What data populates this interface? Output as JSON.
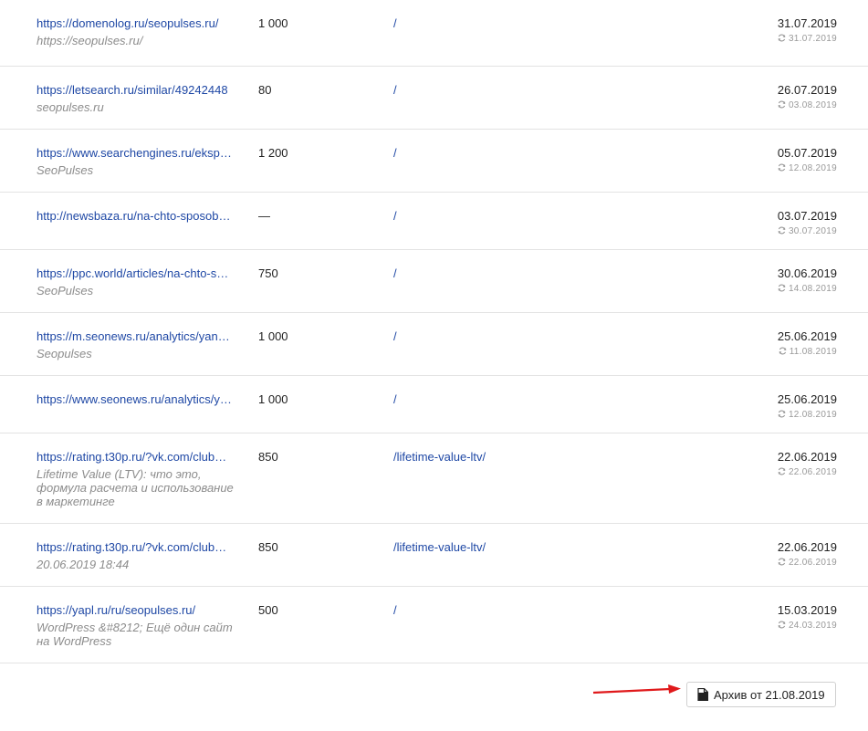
{
  "rows": [
    {
      "url": "https://domenolog.ru/seopulses.ru/",
      "desc": "https://seopulses.ru/",
      "count": "1 000",
      "target": "/",
      "date": "31.07.2019",
      "updated": "31.07.2019"
    },
    {
      "url": "https://letsearch.ru/similar/49242448",
      "desc": "seopulses.ru",
      "count": "80",
      "target": "/",
      "date": "26.07.2019",
      "updated": "03.08.2019"
    },
    {
      "url": "https://www.searchengines.ru/eksp…",
      "desc": "SeoPulses",
      "count": "1 200",
      "target": "/",
      "date": "05.07.2019",
      "updated": "12.08.2019"
    },
    {
      "url": "http://newsbaza.ru/na-chto-sposob…",
      "desc": "",
      "count": "—",
      "target": "/",
      "date": "03.07.2019",
      "updated": "30.07.2019"
    },
    {
      "url": "https://ppc.world/articles/na-chto-s…",
      "desc": "SeoPulses",
      "count": "750",
      "target": "/",
      "date": "30.06.2019",
      "updated": "14.08.2019"
    },
    {
      "url": "https://m.seonews.ru/analytics/yan…",
      "desc": "Seopulses",
      "count": "1 000",
      "target": "/",
      "date": "25.06.2019",
      "updated": "11.08.2019"
    },
    {
      "url": "https://www.seonews.ru/analytics/y…",
      "desc": "",
      "count": "1 000",
      "target": "/",
      "date": "25.06.2019",
      "updated": "12.08.2019"
    },
    {
      "url": "https://rating.t30p.ru/?vk.com/club…",
      "desc": "Lifetime Value (LTV): что это, формула расчета и использование в маркетинге",
      "count": "850",
      "target": "/lifetime-value-ltv/",
      "date": "22.06.2019",
      "updated": "22.06.2019"
    },
    {
      "url": "https://rating.t30p.ru/?vk.com/club…",
      "desc": "20.06.2019 18:44",
      "count": "850",
      "target": "/lifetime-value-ltv/",
      "date": "22.06.2019",
      "updated": "22.06.2019"
    },
    {
      "url": "https://yapl.ru/ru/seopulses.ru/",
      "desc": "WordPress &#8212; Ещё один сайт на WordPress",
      "count": "500",
      "target": "/",
      "date": "15.03.2019",
      "updated": "24.03.2019"
    }
  ],
  "archive_button": {
    "label": "Архив от 21.08.2019",
    "icon": "document-icon"
  },
  "annotation": {
    "icon": "red-arrow",
    "color": "#e0191b"
  },
  "colors": {
    "link": "#1f48a5",
    "muted": "#8c8c8c",
    "divider": "#e3e3e3"
  }
}
